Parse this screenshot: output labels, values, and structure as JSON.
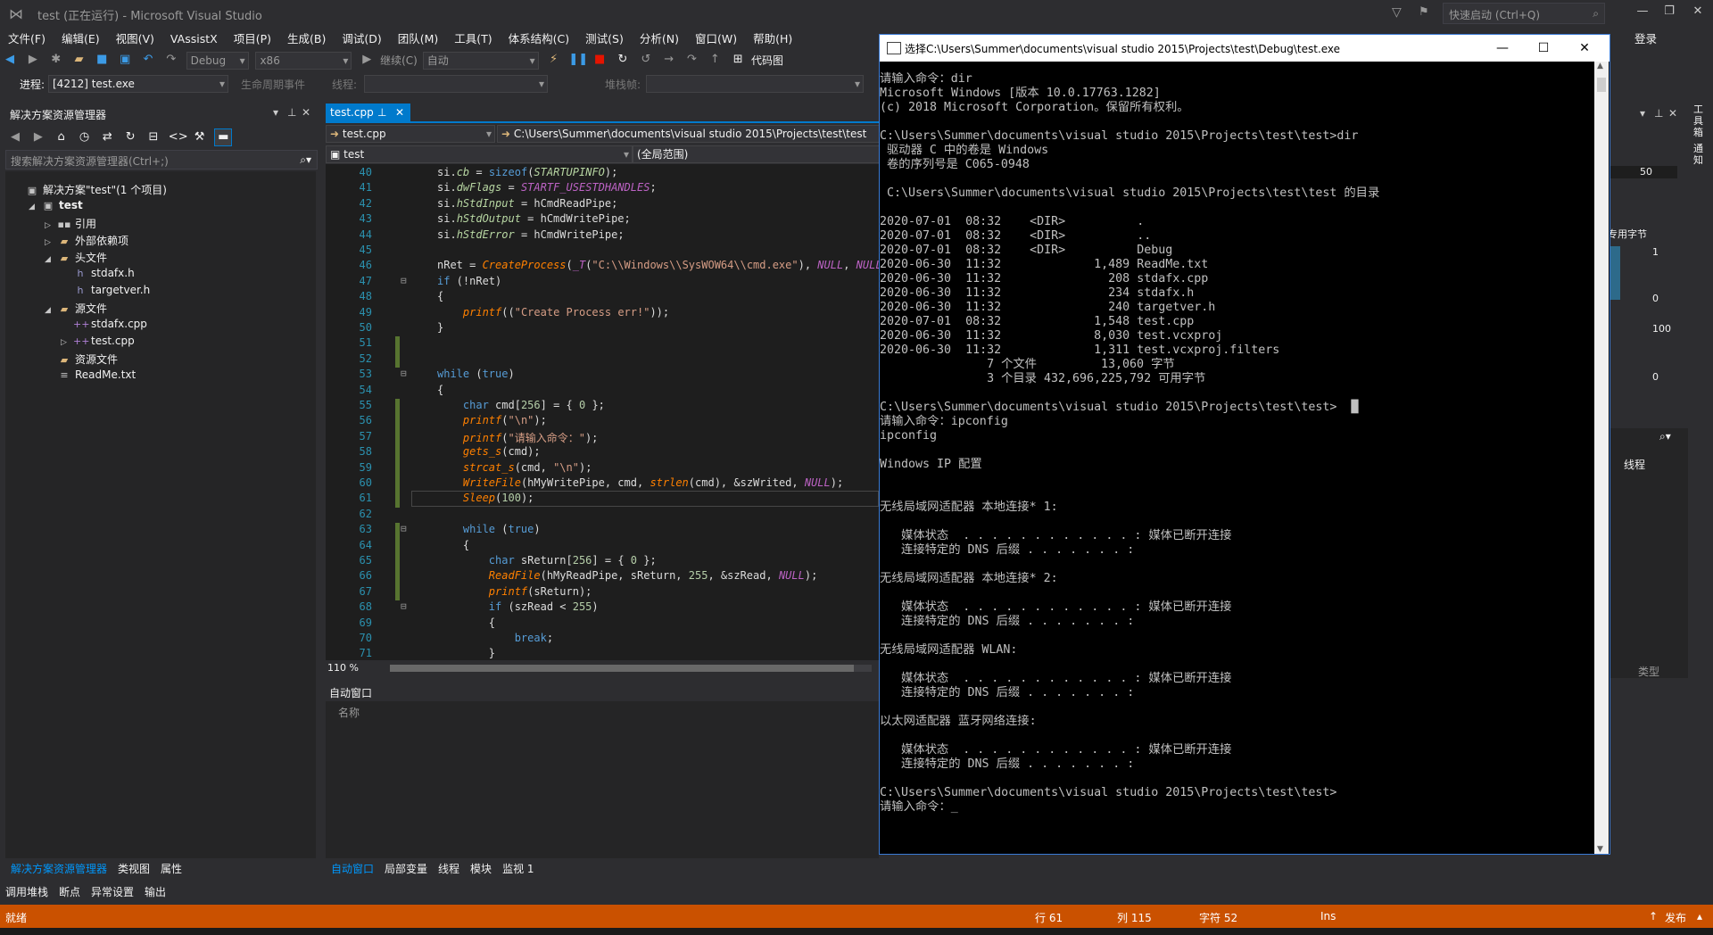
{
  "window": {
    "title": "test (正在运行) - Microsoft Visual Studio",
    "quick_launch": "快速启动 (Ctrl+Q)",
    "login": "登录"
  },
  "menu": [
    "文件(F)",
    "编辑(E)",
    "视图(V)",
    "VAssistX",
    "项目(P)",
    "生成(B)",
    "调试(D)",
    "团队(M)",
    "工具(T)",
    "体系结构(C)",
    "测试(S)",
    "分析(N)",
    "窗口(W)",
    "帮助(H)"
  ],
  "toolbar": {
    "config": "Debug",
    "platform": "x86",
    "continue": "继续(C)",
    "auto": "自动",
    "code_map": "代码图"
  },
  "toolbar2": {
    "process_label": "进程:",
    "process": "[4212] test.exe",
    "lifecycle": "生命周期事件",
    "thread": "线程:",
    "stack": "堆栈帧:"
  },
  "solution_explorer": {
    "title": "解决方案资源管理器",
    "search_placeholder": "搜索解决方案资源管理器(Ctrl+;)",
    "tree": [
      {
        "label": "解决方案\"test\"(1 个项目)",
        "depth": 0,
        "expand": "",
        "icon": "solution"
      },
      {
        "label": "test",
        "depth": 1,
        "expand": "open",
        "icon": "project"
      },
      {
        "label": "引用",
        "depth": 2,
        "expand": "closed",
        "icon": "ref"
      },
      {
        "label": "外部依赖项",
        "depth": 2,
        "expand": "closed",
        "icon": "folder"
      },
      {
        "label": "头文件",
        "depth": 2,
        "expand": "open",
        "icon": "folder"
      },
      {
        "label": "stdafx.h",
        "depth": 3,
        "expand": "",
        "icon": "h"
      },
      {
        "label": "targetver.h",
        "depth": 3,
        "expand": "",
        "icon": "h"
      },
      {
        "label": "源文件",
        "depth": 2,
        "expand": "open",
        "icon": "folder"
      },
      {
        "label": "stdafx.cpp",
        "depth": 3,
        "expand": "",
        "icon": "cpp"
      },
      {
        "label": "test.cpp",
        "depth": 3,
        "expand": "closed",
        "icon": "cpp"
      },
      {
        "label": "资源文件",
        "depth": 2,
        "expand": "",
        "icon": "folder"
      },
      {
        "label": "ReadMe.txt",
        "depth": 2,
        "expand": "",
        "icon": "txt"
      }
    ],
    "tabs": [
      "解决方案资源管理器",
      "类视图",
      "属性"
    ]
  },
  "editor": {
    "tab": "test.cpp",
    "nav_file": "test.cpp",
    "nav_path": "C:\\Users\\Summer\\documents\\visual studio 2015\\Projects\\test\\test",
    "nav_project": "test",
    "nav_scope": "(全局范围)",
    "zoom": "110 %",
    "lines": [
      {
        "n": "40",
        "html": "si.<span class=\"mv\">cb</span> = <span class=\"kw\">sizeof</span>(<span class=\"mv\">STARTUPINFO</span>);"
      },
      {
        "n": "41",
        "html": "si.<span class=\"mv\">dwFlags</span> = <span class=\"mc\">STARTF_USESTDHANDLES</span>;"
      },
      {
        "n": "42",
        "html": "si.<span class=\"mv\">hStdInput</span> = hCmdReadPipe;"
      },
      {
        "n": "43",
        "html": "si.<span class=\"mv\">hStdOutput</span> = hCmdWritePipe;"
      },
      {
        "n": "44",
        "html": "si.<span class=\"mv\">hStdError</span> = hCmdWritePipe;"
      },
      {
        "n": "45",
        "html": ""
      },
      {
        "n": "46",
        "html": "nRet = <span class=\"fn\">CreateProcess</span>(<span class=\"mc\">_T</span>(<span class=\"st\">\"C:\\\\Windows\\\\SysWOW64\\\\cmd.exe\"</span>), <span class=\"mc\">NULL</span>, <span class=\"mc\">NULL</span>"
      },
      {
        "n": "47",
        "html": "<span class=\"kw\">if</span> (!nRet)"
      },
      {
        "n": "48",
        "html": "{"
      },
      {
        "n": "49",
        "html": "    <span class=\"fn\">printf</span>((<span class=\"st\">\"Create Process err!\"</span>));"
      },
      {
        "n": "50",
        "html": "}"
      },
      {
        "n": "51",
        "html": ""
      },
      {
        "n": "52",
        "html": ""
      },
      {
        "n": "53",
        "html": "<span class=\"kw\">while</span> (<span class=\"kw\">true</span>)"
      },
      {
        "n": "54",
        "html": "{"
      },
      {
        "n": "55",
        "html": "    <span class=\"kw\">char</span> cmd[<span class=\"num\">256</span>] = { <span class=\"num\">0</span> };"
      },
      {
        "n": "56",
        "html": "    <span class=\"fn\">printf</span>(<span class=\"st\">\"\\n\"</span>);"
      },
      {
        "n": "57",
        "html": "    <span class=\"fn\">printf</span>(<span class=\"st\">\"请输入命令：\"</span>);"
      },
      {
        "n": "58",
        "html": "    <span class=\"fn\">gets_s</span>(cmd);"
      },
      {
        "n": "59",
        "html": "    <span class=\"fn\">strcat_s</span>(cmd, <span class=\"st\">\"\\n\"</span>);"
      },
      {
        "n": "60",
        "html": "    <span class=\"fn\">WriteFile</span>(hMyWritePipe, cmd, <span class=\"fn\">strlen</span>(cmd), &amp;szWrited, <span class=\"mc\">NULL</span>);"
      },
      {
        "n": "61",
        "html": "    <span class=\"fn\">Sleep</span>(<span class=\"num\">100</span>);"
      },
      {
        "n": "62",
        "html": ""
      },
      {
        "n": "63",
        "html": "    <span class=\"kw\">while</span> (<span class=\"kw\">true</span>)"
      },
      {
        "n": "64",
        "html": "    {"
      },
      {
        "n": "65",
        "html": "        <span class=\"kw\">char</span> sReturn[<span class=\"num\">256</span>] = { <span class=\"num\">0</span> };"
      },
      {
        "n": "66",
        "html": "        <span class=\"fn\">ReadFile</span>(hMyReadPipe, sReturn, <span class=\"num\">255</span>, &amp;szRead, <span class=\"mc\">NULL</span>);"
      },
      {
        "n": "67",
        "html": "        <span class=\"fn\">printf</span>(sReturn);"
      },
      {
        "n": "68",
        "html": "        <span class=\"kw\">if</span> (szRead &lt; <span class=\"num\">255</span>)"
      },
      {
        "n": "69",
        "html": "        {"
      },
      {
        "n": "70",
        "html": "            <span class=\"kw\">break</span>;"
      },
      {
        "n": "71",
        "html": "        }"
      }
    ]
  },
  "autos": {
    "title": "自动窗口",
    "col_name": "名称",
    "col_type": "类型"
  },
  "debug_tabs": [
    "自动窗口",
    "局部变量",
    "线程",
    "模块",
    "监视 1"
  ],
  "bottom_tabs": [
    "调用堆栈",
    "断点",
    "异常设置",
    "输出"
  ],
  "right_panel": {
    "num1": "50",
    "num2": "1",
    "num3": "0",
    "num4": "100",
    "num5": "0",
    "label1": "专用字节",
    "label2": "线程",
    "strip1": "工具箱",
    "strip2": "通知"
  },
  "status": {
    "ready": "就绪",
    "row": "行 61",
    "col": "列 115",
    "char": "字符 52",
    "ins": "Ins",
    "publish": "发布"
  },
  "console": {
    "title": "选择C:\\Users\\Summer\\documents\\visual studio 2015\\Projects\\test\\Debug\\test.exe",
    "text": "请输入命令：dir\nMicrosoft Windows [版本 10.0.17763.1282]\n(c) 2018 Microsoft Corporation。保留所有权利。\n\nC:\\Users\\Summer\\documents\\visual studio 2015\\Projects\\test\\test>dir\n 驱动器 C 中的卷是 Windows\n 卷的序列号是 C065-0948\n\n C:\\Users\\Summer\\documents\\visual studio 2015\\Projects\\test\\test 的目录\n\n2020-07-01  08:32    <DIR>          .\n2020-07-01  08:32    <DIR>          ..\n2020-07-01  08:32    <DIR>          Debug\n2020-06-30  11:32             1,489 ReadMe.txt\n2020-06-30  11:32               208 stdafx.cpp\n2020-06-30  11:32               234 stdafx.h\n2020-06-30  11:32               240 targetver.h\n2020-07-01  08:32             1,548 test.cpp\n2020-06-30  11:32             8,030 test.vcxproj\n2020-06-30  11:32             1,311 test.vcxproj.filters\n               7 个文件         13,060 字节\n               3 个目录 432,696,225,792 可用字节\n\nC:\\Users\\Summer\\documents\\visual studio 2015\\Projects\\test\\test>  █\n请输入命令：ipconfig\nipconfig\n\nWindows IP 配置\n\n\n无线局域网适配器 本地连接* 1:\n\n   媒体状态  . . . . . . . . . . . . : 媒体已断开连接\n   连接特定的 DNS 后缀 . . . . . . . :\n\n无线局域网适配器 本地连接* 2:\n\n   媒体状态  . . . . . . . . . . . . : 媒体已断开连接\n   连接特定的 DNS 后缀 . . . . . . . :\n\n无线局域网适配器 WLAN:\n\n   媒体状态  . . . . . . . . . . . . : 媒体已断开连接\n   连接特定的 DNS 后缀 . . . . . . . :\n\n以太网适配器 蓝牙网络连接:\n\n   媒体状态  . . . . . . . . . . . . : 媒体已断开连接\n   连接特定的 DNS 后缀 . . . . . . . :\n\nC:\\Users\\Summer\\documents\\visual studio 2015\\Projects\\test\\test>\n请输入命令：_"
  }
}
